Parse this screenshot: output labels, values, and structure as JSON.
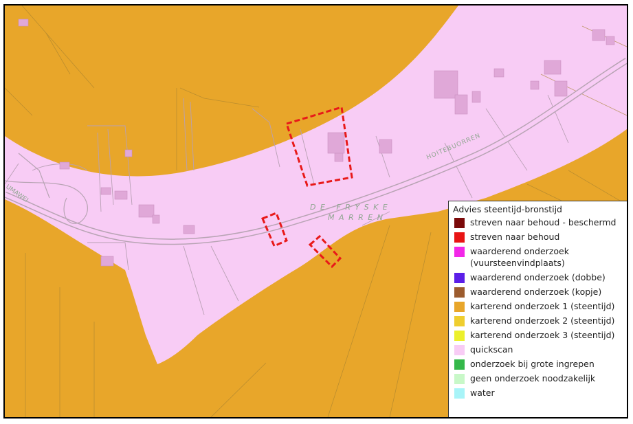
{
  "map": {
    "labels": {
      "place_line1": "DE FRYSKE",
      "place_line2": "MARREN",
      "road_east": "HOITEBUORREN",
      "road_west": "UMAWEI"
    },
    "colors": {
      "karterend1": "#e8a62a",
      "quickscan": "#f8ccf5",
      "survey_outline": "#e81919",
      "road_casing": "#b8a4b4",
      "parcel_line": "#9a8f96"
    }
  },
  "legend": {
    "title": "Advies steentijd-bronstijd",
    "items": [
      {
        "label": "streven naar behoud - beschermd",
        "color": "#7b0a0a"
      },
      {
        "label": "streven naar behoud",
        "color": "#e81414"
      },
      {
        "label": "waarderend onderzoek (vuursteenvindplaats)",
        "color": "#f227e8"
      },
      {
        "label": "waarderend onderzoek (dobbe)",
        "color": "#5b1ee8"
      },
      {
        "label": "waarderend onderzoek (kopje)",
        "color": "#9c5c2e"
      },
      {
        "label": "karterend onderzoek 1 (steentijd)",
        "color": "#e8a62a"
      },
      {
        "label": "karterend onderzoek 2 (steentijd)",
        "color": "#efce2f"
      },
      {
        "label": "karterend onderzoek 3 (steentijd)",
        "color": "#ecf02b"
      },
      {
        "label": "quickscan",
        "color": "#f8ccf5"
      },
      {
        "label": "onderzoek bij grote ingrepen",
        "color": "#34b84a"
      },
      {
        "label": "geen onderzoek noodzakelijk",
        "color": "#c8f8c8"
      },
      {
        "label": "water",
        "color": "#a8f4f8"
      }
    ]
  }
}
